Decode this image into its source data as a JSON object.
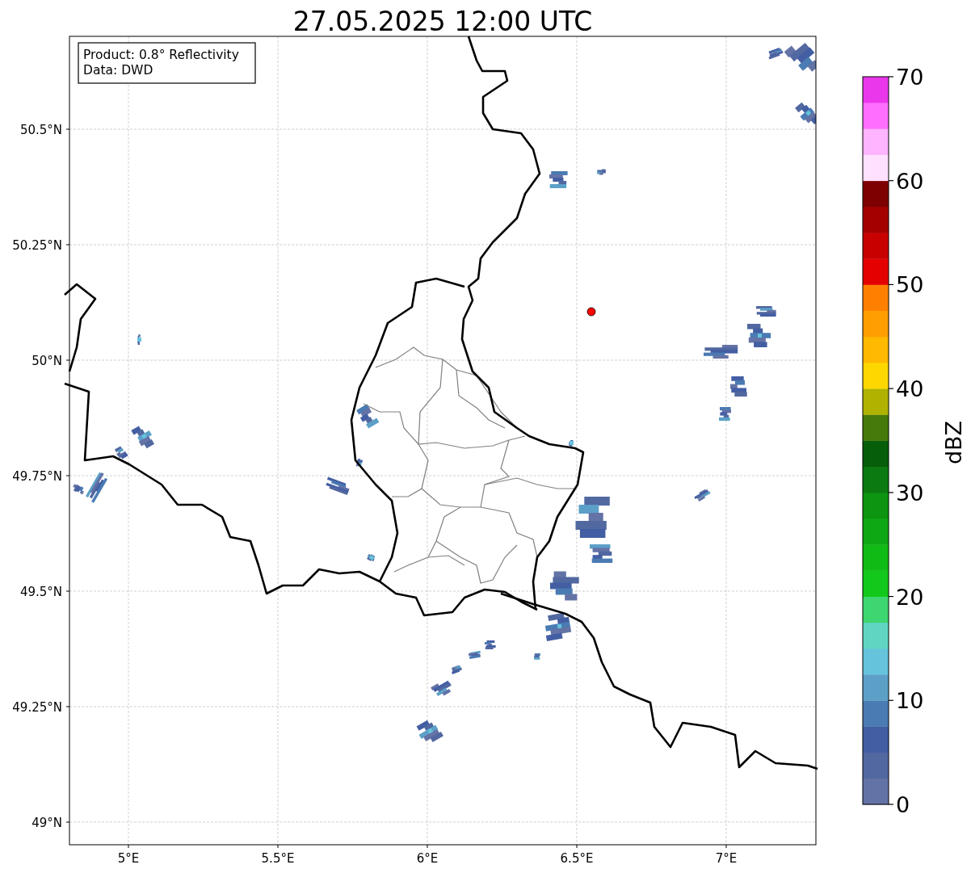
{
  "figure": {
    "title": "27.05.2025 12:00 UTC"
  },
  "info_box": {
    "lines": [
      "Product: 0.8° Reflectivity",
      "Data: DWD"
    ]
  },
  "map": {
    "x_ticks": [
      "5°E",
      "5.5°E",
      "6°E",
      "6.5°E",
      "7°E"
    ],
    "y_ticks": [
      "50.5°N",
      "50.25°N",
      "50°N",
      "49.75°N",
      "49.5°N",
      "49.25°N",
      "49°N"
    ]
  },
  "colorbar": {
    "label": "dBZ",
    "ticks": [
      "70",
      "60",
      "50",
      "40",
      "30",
      "20",
      "10",
      "0"
    ],
    "bins": [
      {
        "color": "#6473a6"
      },
      {
        "color": "#5268a0"
      },
      {
        "color": "#435ea3"
      },
      {
        "color": "#4a7bb3"
      },
      {
        "color": "#5ca0c8"
      },
      {
        "color": "#66c3dc"
      },
      {
        "color": "#60d6c2"
      },
      {
        "color": "#3ed670"
      },
      {
        "color": "#12c81a"
      },
      {
        "color": "#10bb15"
      },
      {
        "color": "#0ea814"
      },
      {
        "color": "#0d9410"
      },
      {
        "color": "#0b7a10"
      },
      {
        "color": "#075e0a"
      },
      {
        "color": "#467a0a"
      },
      {
        "color": "#b0b200"
      },
      {
        "color": "#ffd700"
      },
      {
        "color": "#ffb900"
      },
      {
        "color": "#ff9e00"
      },
      {
        "color": "#ff8000"
      },
      {
        "color": "#e40000"
      },
      {
        "color": "#c80000"
      },
      {
        "color": "#a50000"
      },
      {
        "color": "#7f0000"
      },
      {
        "color": "#ffe0ff"
      },
      {
        "color": "#ffb4ff"
      },
      {
        "color": "#ff6eff"
      },
      {
        "color": "#eb37eb"
      }
    ]
  }
}
